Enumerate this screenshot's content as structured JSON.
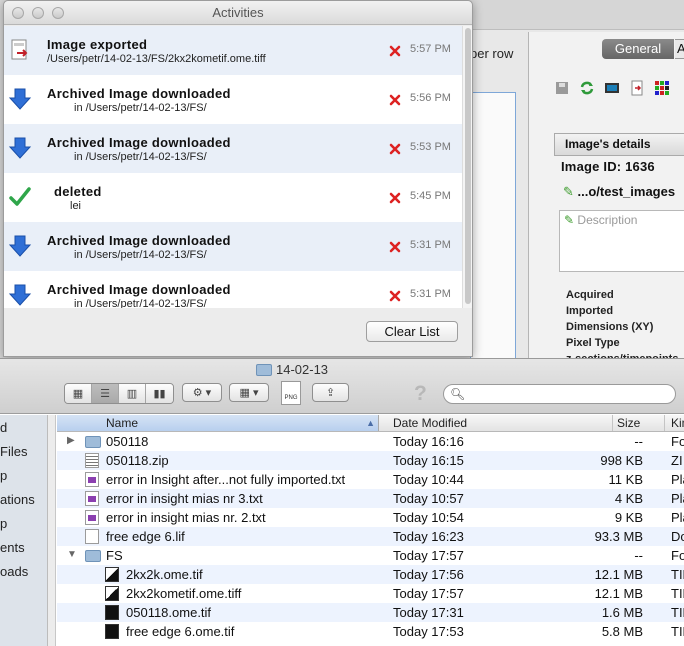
{
  "activities": {
    "title": "Activities",
    "clear_label": "Clear List",
    "items": [
      {
        "title": "Image exported",
        "sub": "/Users/petr/14-02-13/FS/2kx2kometif.ome.tiff",
        "time": "5:57 PM",
        "icon": "export-doc-icon"
      },
      {
        "title": "Archived Image downloaded",
        "sub": "in /Users/petr/14-02-13/FS/",
        "time": "5:56 PM",
        "icon": "download-arrow-icon"
      },
      {
        "title": "Archived Image downloaded",
        "sub": "in /Users/petr/14-02-13/FS/",
        "time": "5:53 PM",
        "icon": "download-arrow-icon"
      },
      {
        "title": "deleted",
        "sub": "lei",
        "time": "5:45 PM",
        "icon": "checkmark-icon"
      },
      {
        "title": "Archived Image downloaded",
        "sub": "in /Users/petr/14-02-13/FS/",
        "time": "5:31 PM",
        "icon": "download-arrow-icon"
      },
      {
        "title": "Archived Image downloaded",
        "sub": "in /Users/petr/14-02-13/FS/",
        "time": "5:31 PM",
        "icon": "download-arrow-icon"
      }
    ]
  },
  "background_app": {
    "per_row_text": "per row",
    "tab_general": "General",
    "tab_more": "A",
    "details_header": "Image's details",
    "image_id": "Image ID: 1636",
    "path": "...o/test_images",
    "description_placeholder": "Description",
    "meta_labels": [
      "Acquired",
      "Imported",
      "Dimensions (XY)",
      "Pixel Type",
      "z-sections/timepoints"
    ]
  },
  "finder": {
    "title": "14-02-13",
    "search_placeholder": "",
    "png_label": "PNG",
    "help_glyph": "?",
    "sidebar": [
      "d",
      "Files",
      "p",
      "ations",
      "p",
      "ents",
      "oads"
    ],
    "columns": {
      "name": "Name",
      "date": "Date Modified",
      "size": "Size",
      "kind": "Kin"
    },
    "rows": [
      {
        "name": "050118",
        "date": "Today 16:16",
        "size": "--",
        "kind": "Fo",
        "icon": "folder",
        "indent": 0,
        "disclosure": "closed"
      },
      {
        "name": "050118.zip",
        "date": "Today 16:15",
        "size": "998 KB",
        "kind": "ZI",
        "icon": "zip",
        "indent": 0,
        "disclosure": ""
      },
      {
        "name": "error in Insight after...not fully imported.txt",
        "date": "Today 10:44",
        "size": "11 KB",
        "kind": "Pla",
        "icon": "txt",
        "indent": 0,
        "disclosure": ""
      },
      {
        "name": "error in insight mias nr 3.txt",
        "date": "Today 10:57",
        "size": "4 KB",
        "kind": "Pla",
        "icon": "txt",
        "indent": 0,
        "disclosure": ""
      },
      {
        "name": "error in insight mias nr. 2.txt",
        "date": "Today 10:54",
        "size": "9 KB",
        "kind": "Pla",
        "icon": "txt",
        "indent": 0,
        "disclosure": ""
      },
      {
        "name": "free edge 6.lif",
        "date": "Today 16:23",
        "size": "93.3 MB",
        "kind": "Do",
        "icon": "doc",
        "indent": 0,
        "disclosure": ""
      },
      {
        "name": "FS",
        "date": "Today 17:57",
        "size": "--",
        "kind": "Fo",
        "icon": "folder",
        "indent": 0,
        "disclosure": "open"
      },
      {
        "name": "2kx2k.ome.tif",
        "date": "Today 17:56",
        "size": "12.1 MB",
        "kind": "TIF",
        "icon": "tif",
        "indent": 1,
        "disclosure": ""
      },
      {
        "name": "2kx2kometif.ome.tiff",
        "date": "Today 17:57",
        "size": "12.1 MB",
        "kind": "TIF",
        "icon": "tif",
        "indent": 1,
        "disclosure": ""
      },
      {
        "name": "050118.ome.tif",
        "date": "Today 17:31",
        "size": "1.6 MB",
        "kind": "TIF",
        "icon": "black",
        "indent": 1,
        "disclosure": ""
      },
      {
        "name": "free edge 6.ome.tif",
        "date": "Today 17:53",
        "size": "5.8 MB",
        "kind": "TIF",
        "icon": "black",
        "indent": 1,
        "disclosure": ""
      }
    ]
  }
}
